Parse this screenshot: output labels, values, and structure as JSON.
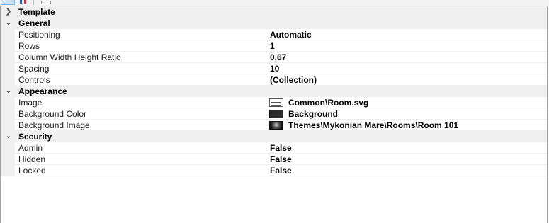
{
  "toolbar": {
    "categorized_icon": "sort-categorized-icon",
    "alphabetical_icon": "sort-alphabetical-icon",
    "property_pages_icon": "property-pages-icon"
  },
  "grid": {
    "categories": {
      "template": {
        "label": "Template",
        "expanded": false
      },
      "general": {
        "label": "General",
        "expanded": true,
        "props": [
          {
            "name": "Positioning",
            "value": "Automatic"
          },
          {
            "name": "Rows",
            "value": "1"
          },
          {
            "name": "Column Width Height Ratio",
            "value": "0,67"
          },
          {
            "name": "Spacing",
            "value": "10"
          },
          {
            "name": "Controls",
            "value": "(Collection)"
          }
        ]
      },
      "appearance": {
        "label": "Appearance",
        "expanded": true,
        "props": [
          {
            "name": "Image",
            "value": "Common\\Room.svg",
            "swatch": "image-thumbnail-icon"
          },
          {
            "name": "Background Color",
            "value": "Background",
            "swatch": "color-swatch-icon",
            "color": "#2b2b2b"
          },
          {
            "name": "Background Image",
            "value": "Themes\\Mykonian Mare\\Rooms\\Room 101",
            "swatch": "image-thumbnail-icon"
          }
        ]
      },
      "security": {
        "label": "Security",
        "expanded": true,
        "props": [
          {
            "name": "Admin",
            "value": "False"
          },
          {
            "name": "Hidden",
            "value": "False"
          },
          {
            "name": "Locked",
            "value": "False"
          }
        ]
      }
    }
  }
}
